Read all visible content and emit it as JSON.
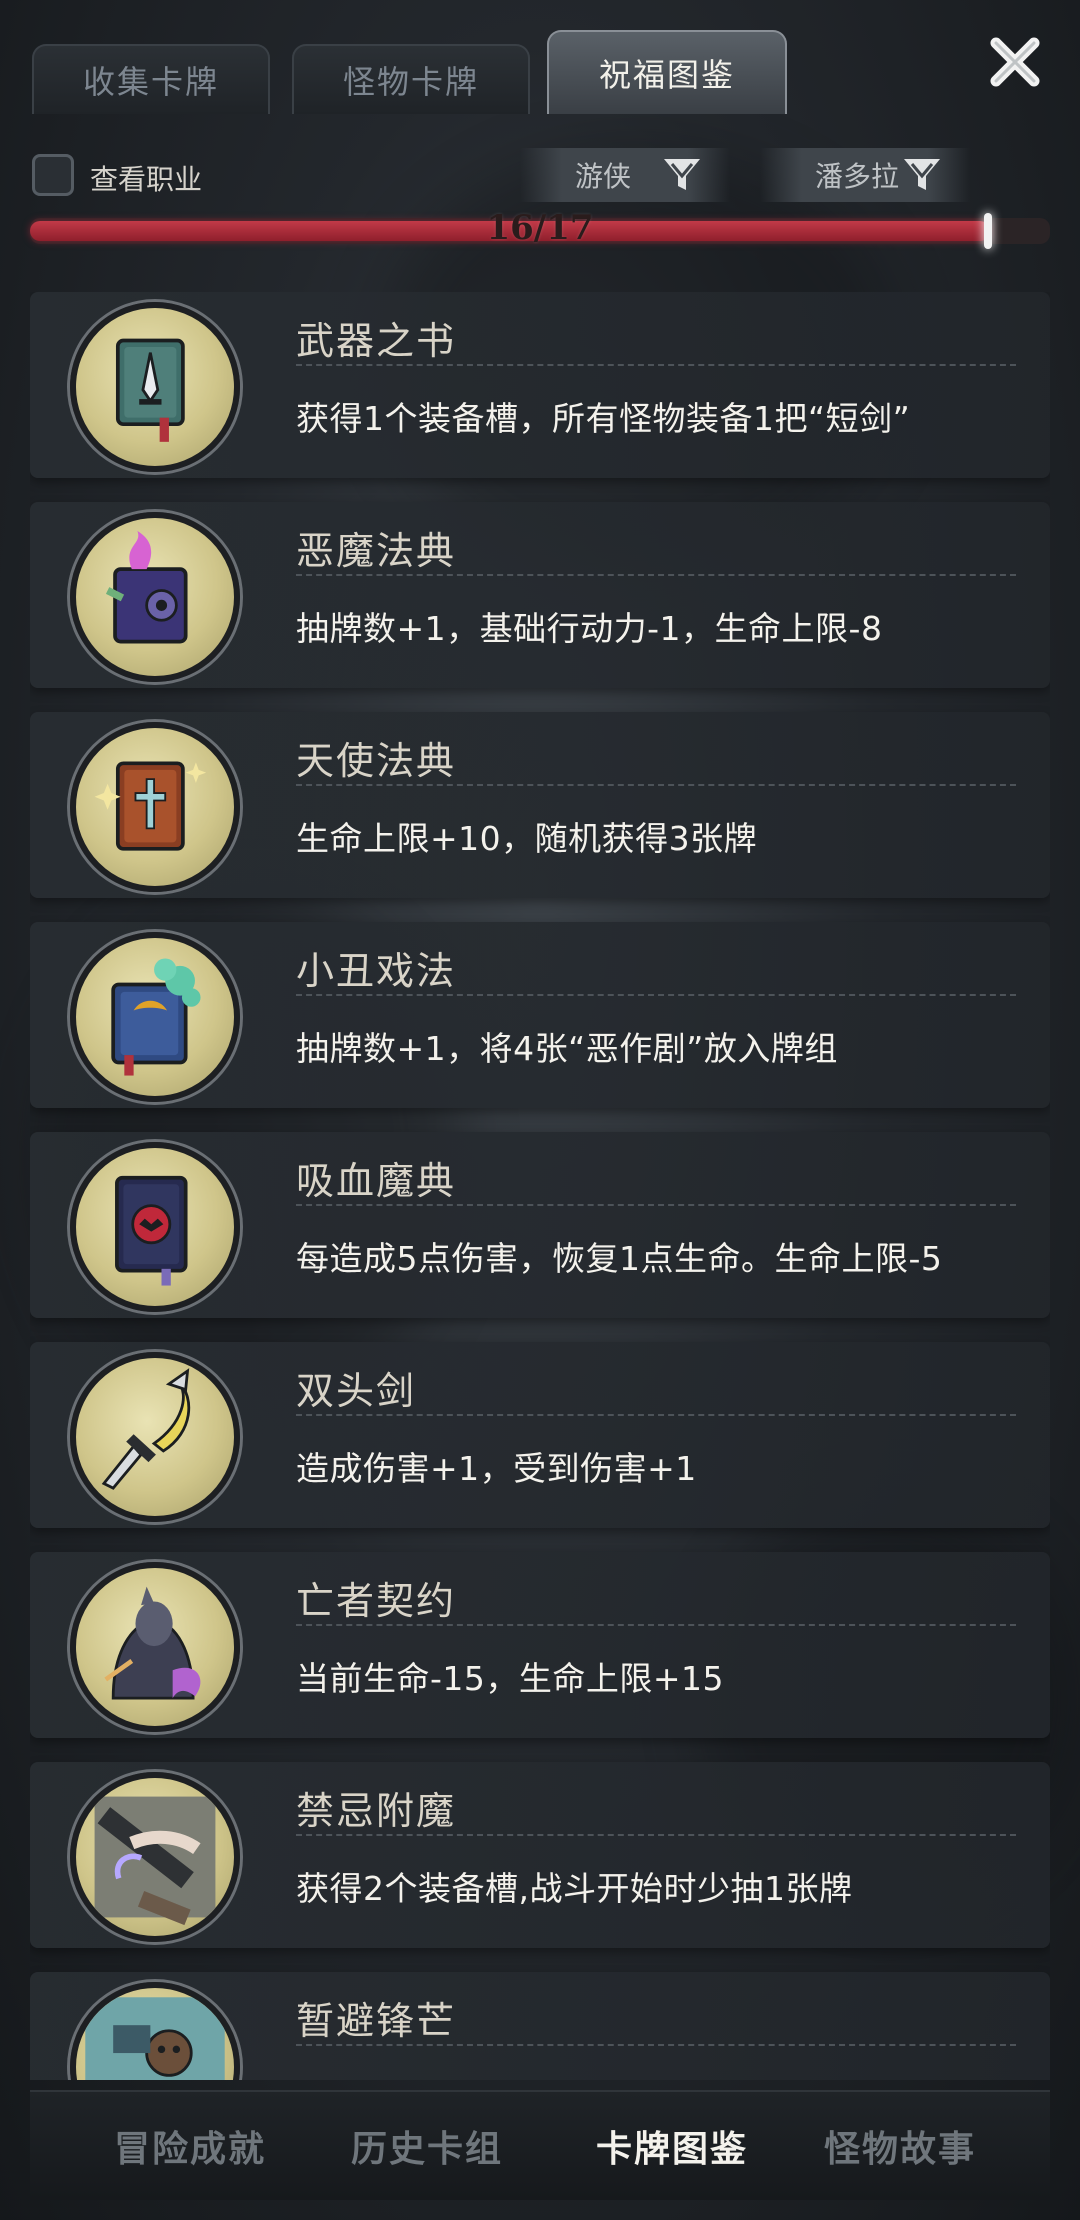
{
  "top_tabs": [
    {
      "label": "收集卡牌"
    },
    {
      "label": "怪物卡牌"
    },
    {
      "label": "祝福图鉴"
    }
  ],
  "active_tab": "祝福图鉴",
  "filters": {
    "checkbox_label": "查看职业",
    "checkbox_checked": false,
    "class_filter": "游侠",
    "character_filter": "潘多拉"
  },
  "progress": {
    "text": "16/17",
    "collected": 16,
    "total": 17
  },
  "blessings": [
    {
      "name": "武器之书",
      "desc": "获得1个装备槽，所有怪物装备1把“短剑”",
      "icon": "weapon-book-icon"
    },
    {
      "name": "恶魔法典",
      "desc": "抽牌数+1，基础行动力-1，生命上限-8",
      "icon": "demon-tome-icon"
    },
    {
      "name": "天使法典",
      "desc": "生命上限+10，随机获得3张牌",
      "icon": "angel-tome-icon"
    },
    {
      "name": "小丑戏法",
      "desc": "抽牌数+1，将4张“恶作剧”放入牌组",
      "icon": "jester-book-icon"
    },
    {
      "name": "吸血魔典",
      "desc": "每造成5点伤害，恢复1点生命。生命上限-5",
      "icon": "vampire-tome-icon"
    },
    {
      "name": "双头剑",
      "desc": "造成伤害+1，受到伤害+1",
      "icon": "double-blade-icon"
    },
    {
      "name": "亡者契约",
      "desc": "当前生命-15，生命上限+15",
      "icon": "undead-pact-icon"
    },
    {
      "name": "禁忌附魔",
      "desc": "获得2个装备槽,战斗开始时少抽1张牌",
      "icon": "forbidden-enchant-icon"
    },
    {
      "name": "暂避锋芒",
      "desc": "",
      "icon": "evade-icon"
    }
  ],
  "bottom_nav": [
    {
      "label": "冒险成就"
    },
    {
      "label": "历史卡组"
    },
    {
      "label": "卡牌图鉴"
    },
    {
      "label": "怪物故事"
    }
  ],
  "active_bottom": "卡牌图鉴",
  "colors": {
    "progress": "#b52d3c",
    "accent": "#f4f2ec",
    "emblem": "#d9d09a"
  }
}
